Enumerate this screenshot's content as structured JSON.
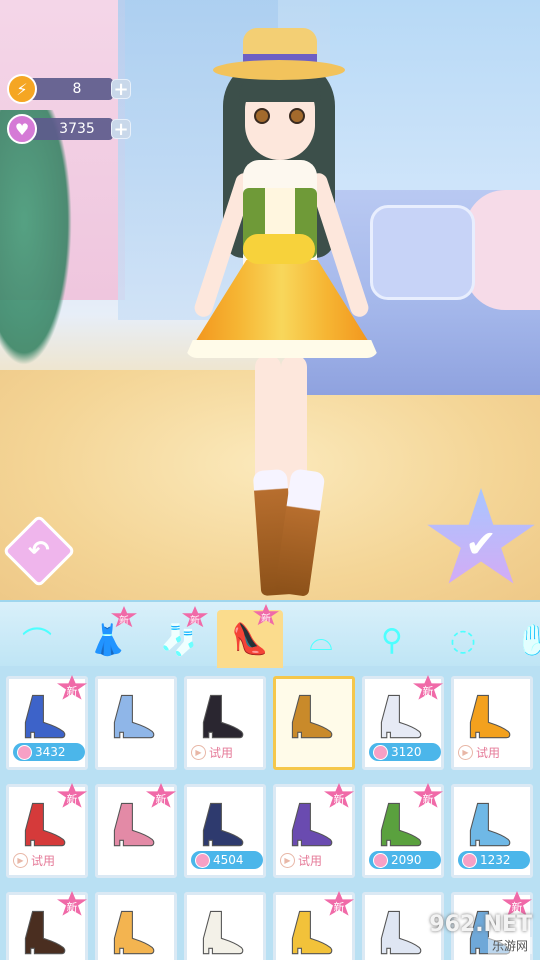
{
  "hud": {
    "energy": {
      "value": "8",
      "icon": "lightning-icon"
    },
    "gems": {
      "value": "3735",
      "icon": "heart-gem-icon"
    }
  },
  "buttons": {
    "back_icon": "↶",
    "confirm_icon": "✔"
  },
  "tabs": [
    {
      "name": "hair",
      "icon": "hair-icon",
      "new": false
    },
    {
      "name": "dress",
      "icon": "dress-icon",
      "new": true,
      "new_label": "新"
    },
    {
      "name": "socks",
      "icon": "socks-icon",
      "new": true,
      "new_label": "新"
    },
    {
      "name": "shoes",
      "icon": "high-heel-icon",
      "new": true,
      "new_label": "新",
      "active": true
    },
    {
      "name": "headband",
      "icon": "headband-icon",
      "new": false
    },
    {
      "name": "earrings",
      "icon": "earrings-icon",
      "new": false
    },
    {
      "name": "necklace",
      "icon": "necklace-icon",
      "new": false
    },
    {
      "name": "hand",
      "icon": "hand-icon",
      "new": false
    }
  ],
  "items": [
    {
      "color": "#3d63c9",
      "new": true,
      "new_label": "新",
      "type": "price",
      "label": "3432"
    },
    {
      "color": "#8fb6e8",
      "new": false,
      "type": "none"
    },
    {
      "color": "#2a2630",
      "new": false,
      "type": "trial",
      "label": "试用"
    },
    {
      "color": "#c98a2a",
      "new": false,
      "type": "none",
      "selected": true
    },
    {
      "color": "#e6eaf5",
      "new": true,
      "new_label": "新",
      "type": "price",
      "label": "3120"
    },
    {
      "color": "#f3a11e",
      "new": false,
      "type": "trial",
      "label": "试用"
    },
    {
      "color": "#d53a3a",
      "new": true,
      "new_label": "新",
      "type": "trial",
      "label": "试用"
    },
    {
      "color": "#e38aa6",
      "new": true,
      "new_label": "新",
      "type": "none"
    },
    {
      "color": "#2e3a6e",
      "new": false,
      "type": "price",
      "label": "4504"
    },
    {
      "color": "#6a4bb0",
      "new": true,
      "new_label": "新",
      "type": "trial",
      "label": "试用"
    },
    {
      "color": "#5aa13e",
      "new": true,
      "new_label": "新",
      "type": "price",
      "label": "2090"
    },
    {
      "color": "#6fb8e6",
      "new": false,
      "type": "price",
      "label": "1232"
    },
    {
      "color": "#4a2e20",
      "new": true,
      "new_label": "新",
      "type": "none"
    },
    {
      "color": "#f3b450",
      "new": false,
      "type": "none"
    },
    {
      "color": "#f3f1e8",
      "new": false,
      "type": "none"
    },
    {
      "color": "#f2c23a",
      "new": true,
      "new_label": "新",
      "type": "none"
    },
    {
      "color": "#dfe6f3",
      "new": false,
      "type": "none"
    },
    {
      "color": "#6fa8d8",
      "new": true,
      "new_label": "新",
      "type": "none"
    }
  ],
  "watermark": {
    "logo": "962.NET",
    "sub": "乐游网"
  }
}
